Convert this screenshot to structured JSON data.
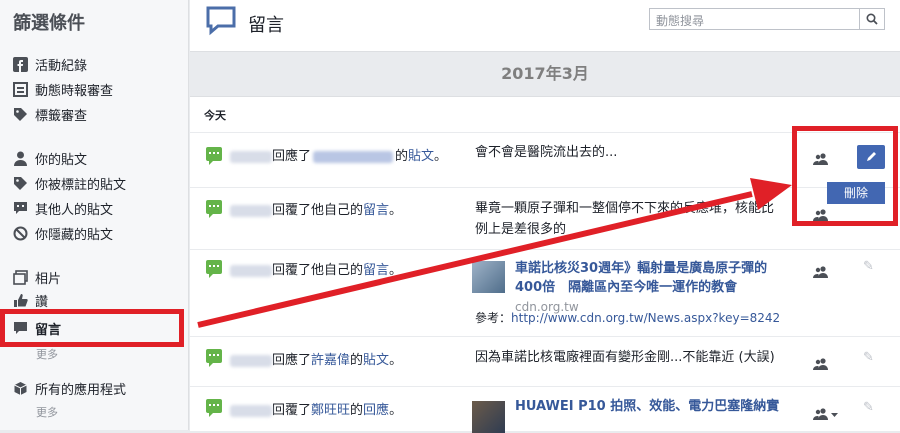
{
  "sidebar": {
    "title": "篩選條件",
    "items": [
      {
        "label": "活動紀錄"
      },
      {
        "label": "動態時報審查"
      },
      {
        "label": "標籤審查"
      },
      {
        "label": "你的貼文"
      },
      {
        "label": "你被標註的貼文"
      },
      {
        "label": "其他人的貼文"
      },
      {
        "label": "你隱藏的貼文"
      },
      {
        "label": "相片"
      },
      {
        "label": "讚"
      },
      {
        "label": "留言"
      },
      {
        "label": "所有的應用程式"
      }
    ],
    "more1": "更多",
    "more2": "更多"
  },
  "header": {
    "title": "留言",
    "search_placeholder": "動態搜尋"
  },
  "month": "2017年3月",
  "today": "今天",
  "rows": [
    {
      "action_mid": "回應了",
      "action_link": "貼文",
      "action_end": "的",
      "suffix": "。",
      "content": "會不會是醫院流出去的..."
    },
    {
      "action": "回覆了他自己的",
      "action_link": "留言",
      "suffix": "。",
      "content": "畢竟一顆原子彈和一整個停不下來的反應堆，核能比例上是差很多的"
    },
    {
      "action": "回覆了他自己的",
      "action_link": "留言",
      "suffix": "。",
      "link_title": "車諾比核災30週年》輻射量是廣島原子彈的400倍　隔離區內至今唯一運作的教會",
      "link_domain": "cdn.org.tw",
      "ref_label": "參考：",
      "ref_url": "http://www.cdn.org.tw/News.aspx?key=8242"
    },
    {
      "action": "回應了",
      "action_link": "許嘉偉",
      "action_link2": "貼文",
      "action_mid": "的",
      "suffix": "。",
      "content": "因為車諾比核電廠裡面有變形金剛...不能靠近 (大誤)"
    },
    {
      "action": "回覆了",
      "action_link": "鄭旺旺",
      "action_link2": "回應",
      "action_mid": "的",
      "suffix": "。",
      "link_title": "HUAWEI P10 拍照、效能、電力巴塞隆納實"
    }
  ],
  "menu": {
    "delete": "刪除"
  },
  "colors": {
    "facebook_blue": "#4267b2",
    "annotation_red": "#e02027",
    "comment_green": "#64b449"
  }
}
